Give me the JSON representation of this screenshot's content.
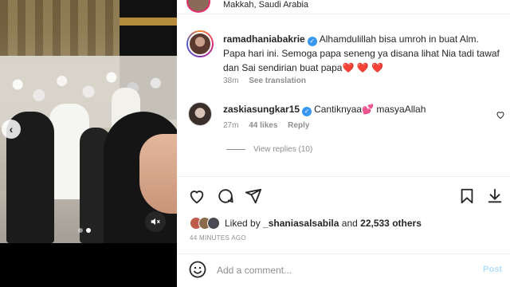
{
  "header": {
    "location": "Makkah, Saudi Arabia"
  },
  "caption": {
    "username": "ramadhaniabakrie",
    "text": "Alhamdulillah bisa umroh in buat Alm. Papa hari ini. Semoga papa seneng ya disana lihat Nia tadi tawaf dan Sai sendirian buat papa",
    "hearts": "❤️ ❤️ ❤️",
    "time": "38m",
    "see_translation": "See translation"
  },
  "comment": {
    "username": "zaskiasungkar15",
    "text": "Cantiknyaa💕 masyaAllah",
    "time": "27m",
    "likes": "44 likes",
    "reply": "Reply"
  },
  "replies": {
    "label": "View replies (10)"
  },
  "likes": {
    "prefix": "Liked by",
    "user": "_shaniasalsabila",
    "joiner": "and",
    "others": "22,533 others"
  },
  "timestamp": "44 MINUTES AGO",
  "add_comment": {
    "placeholder": "Add a comment...",
    "post_label": "Post"
  },
  "colors": {
    "accent_blue": "#3897f0",
    "post_disabled": "#b2dffc",
    "heart_red": "#ed4956"
  }
}
